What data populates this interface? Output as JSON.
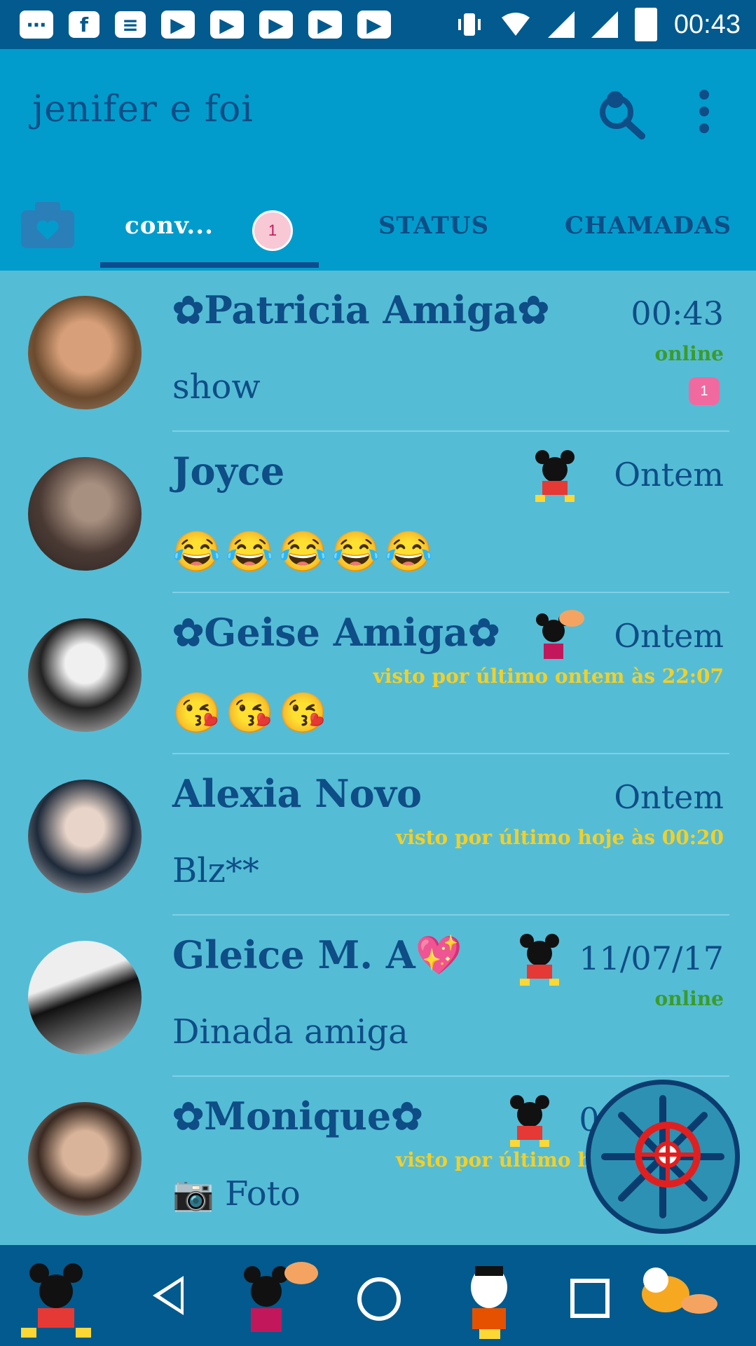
{
  "status_bar": {
    "time": "00:43",
    "icons": [
      "messenger-icon",
      "facebook-icon",
      "news-icon",
      "youtube-icon",
      "youtube-icon",
      "youtube-icon",
      "youtube-icon",
      "youtube-icon",
      "vibrate-icon",
      "wifi-icon",
      "signal-icon",
      "signal-icon",
      "battery-icon"
    ]
  },
  "app_bar": {
    "title": "jenifer e foi",
    "search_icon": "search-icon",
    "menu_icon": "more-vert-icon"
  },
  "tabs": {
    "camera_icon": "camera-icon",
    "conversations": "conv...",
    "conversations_badge": "1",
    "status": "STATUS",
    "calls": "CHAMADAS"
  },
  "chats": [
    {
      "name": "✿Patricia Amiga✿",
      "time": "00:43",
      "presence": "online",
      "message": "show",
      "unread": "1"
    },
    {
      "name": "Joyce",
      "time": "Ontem",
      "presence": "",
      "message": "😂😂😂😂😂"
    },
    {
      "name": "✿Geise Amiga✿",
      "time": "Ontem",
      "presence": "visto por último ontem às 22:07",
      "message": "😘😘😘"
    },
    {
      "name": "Alexia Novo",
      "time": "Ontem",
      "presence": "visto por último hoje às 00:20",
      "message": "Blz**"
    },
    {
      "name": "Gleice M. A💖",
      "time": "11/07/17",
      "presence": "online",
      "message": "Dinada amiga"
    },
    {
      "name": "✿Monique✿",
      "time": "09/07/17",
      "presence": "visto por último hoje às 00:27",
      "message": "📷 Foto"
    }
  ],
  "colors": {
    "status_bar": "#025a8e",
    "app_bar": "#019ccc",
    "list_bg": "#55bcd6",
    "text": "#0e4d86",
    "online": "#3a9c2a",
    "seen": "#f2d028"
  }
}
